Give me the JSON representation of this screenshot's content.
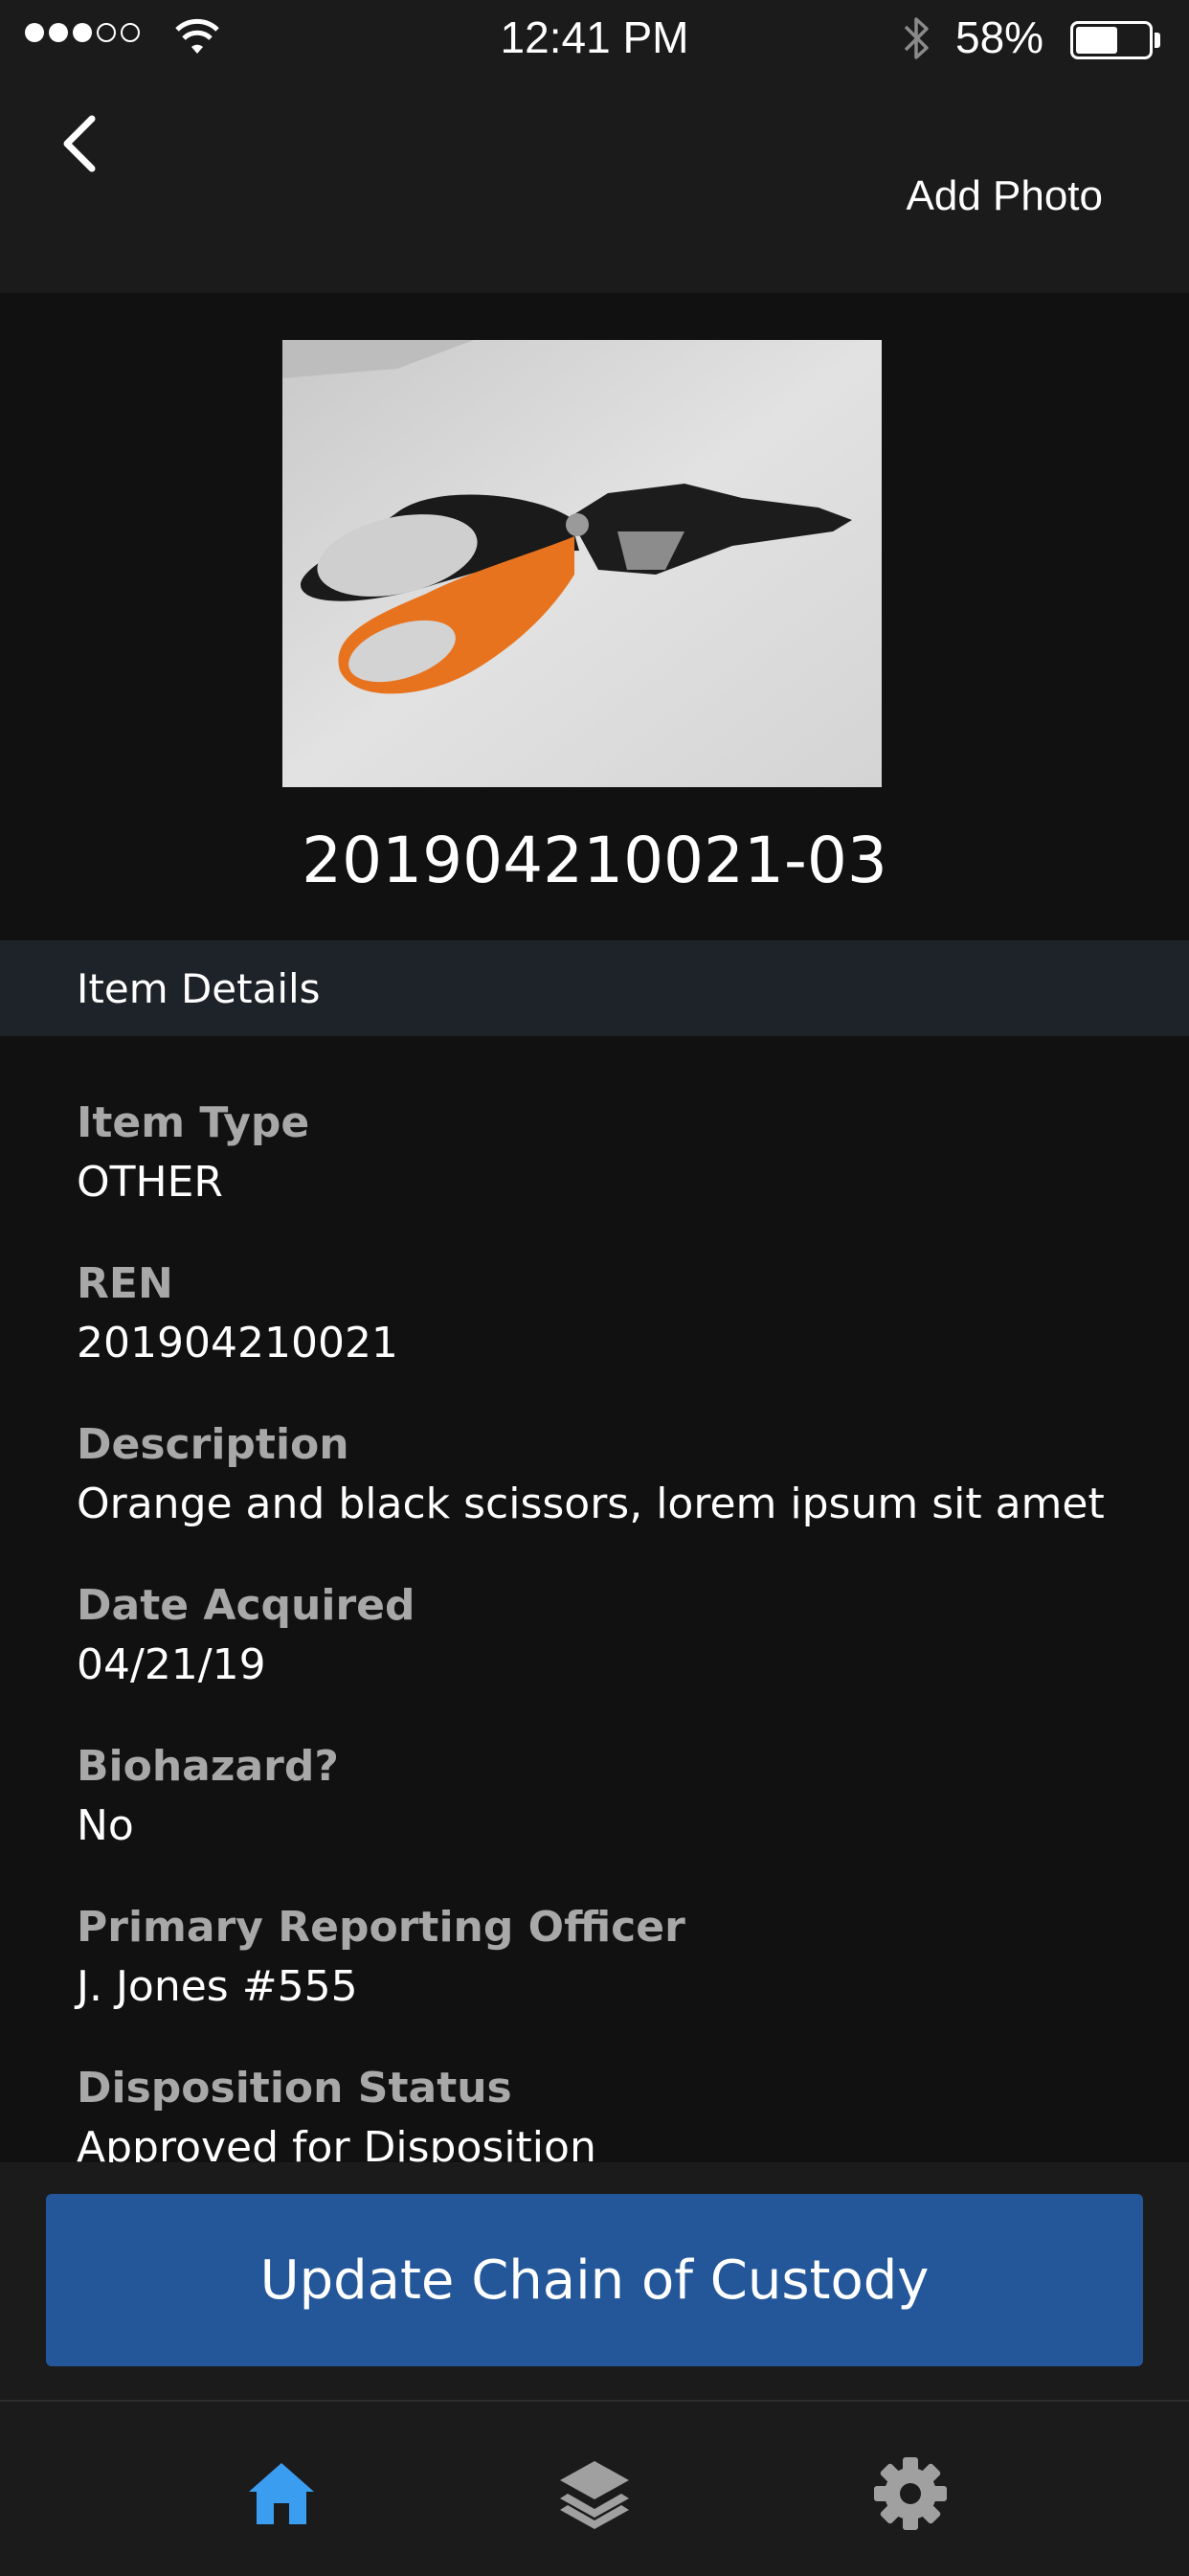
{
  "status_bar": {
    "time": "12:41 PM",
    "battery_percent": "58%",
    "battery_level": 0.58,
    "signal_bars_filled": 3,
    "signal_bars_total": 5
  },
  "nav": {
    "back_icon": "chevron-left-icon",
    "add_photo_label": "Add Photo"
  },
  "item": {
    "photo_description_icon": "photo",
    "id": "201904210021-03"
  },
  "section": {
    "title": "Item Details"
  },
  "details": [
    {
      "label": "Item Type",
      "value": "OTHER"
    },
    {
      "label": "REN",
      "value": "201904210021"
    },
    {
      "label": "Description",
      "value": "Orange and black scissors, lorem ipsum sit amet"
    },
    {
      "label": "Date Acquired",
      "value": "04/21/19"
    },
    {
      "label": "Biohazard?",
      "value": "No"
    },
    {
      "label": "Primary Reporting Officer",
      "value": "J. Jones #555"
    },
    {
      "label": "Disposition Status",
      "value": "Approved for Disposition"
    }
  ],
  "actions": {
    "primary_label": "Update Chain of Custody"
  },
  "tabs": [
    {
      "name": "home",
      "icon": "home-icon",
      "active": true
    },
    {
      "name": "layers",
      "icon": "layers-icon",
      "active": false
    },
    {
      "name": "settings",
      "icon": "gear-icon",
      "active": false
    }
  ],
  "colors": {
    "background": "#111112",
    "bar": "#1b1b1c",
    "section_header": "#1e2229",
    "primary_button": "#23579a",
    "tab_active": "#3b9df0",
    "tab_inactive": "#a0a0a0",
    "label": "#a8a8a8"
  }
}
